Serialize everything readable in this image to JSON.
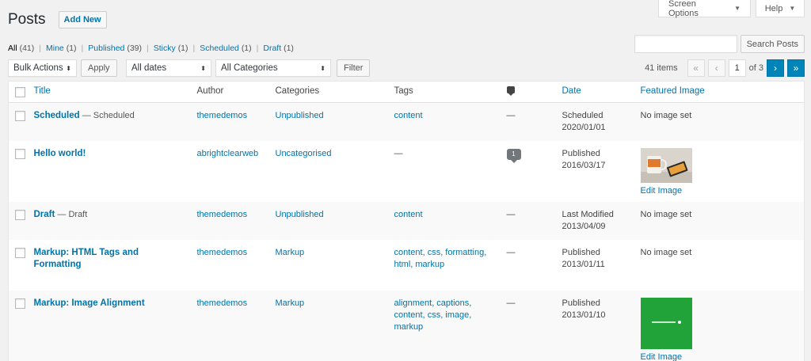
{
  "header": {
    "screen_options": "Screen Options",
    "help": "Help",
    "title": "Posts",
    "add_new": "Add New"
  },
  "filters": {
    "all": "All",
    "all_count": "(41)",
    "mine": "Mine",
    "mine_count": "(1)",
    "published": "Published",
    "published_count": "(39)",
    "sticky": "Sticky",
    "sticky_count": "(1)",
    "scheduled": "Scheduled",
    "scheduled_count": "(1)",
    "draft": "Draft",
    "draft_count": "(1)",
    "separator": "|"
  },
  "search": {
    "button": "Search Posts",
    "value": ""
  },
  "tablenav": {
    "bulk_actions": "Bulk Actions",
    "apply": "Apply",
    "dates": "All dates",
    "categories": "All Categories",
    "filter": "Filter",
    "items": "41 items",
    "first": "«",
    "prev": "‹",
    "current_page": "1",
    "of_pages": "of 3",
    "next": "›",
    "last": "»"
  },
  "columns": {
    "title": "Title",
    "author": "Author",
    "categories": "Categories",
    "tags": "Tags",
    "date": "Date",
    "featured": "Featured Image"
  },
  "rows": [
    {
      "title": "Scheduled",
      "state": " — Scheduled",
      "author": "themedemos",
      "categories": "Unpublished",
      "tags": "content",
      "comments": "—",
      "date_status": "Scheduled",
      "date": "2020/01/01",
      "featured": "No image set"
    },
    {
      "title": "Hello world!",
      "state": "",
      "author": "abrightclearweb",
      "categories": "Uncategorised",
      "tags": "—",
      "comments": "1",
      "date_status": "Published",
      "date": "2016/03/17",
      "featured": "Edit Image"
    },
    {
      "title": "Draft",
      "state": " — Draft",
      "author": "themedemos",
      "categories": "Unpublished",
      "tags": "content",
      "comments": "—",
      "date_status": "Last Modified",
      "date": "2013/04/09",
      "featured": "No image set"
    },
    {
      "title": "Markup: HTML Tags and Formatting",
      "state": "",
      "author": "themedemos",
      "categories": "Markup",
      "tags": "content, css, formatting, html, markup",
      "comments": "—",
      "date_status": "Published",
      "date": "2013/01/11",
      "featured": "No image set"
    },
    {
      "title": "Markup: Image Alignment",
      "state": "",
      "author": "themedemos",
      "categories": "Markup",
      "tags": "alignment, captions, content, css, image, markup",
      "comments": "—",
      "date_status": "Published",
      "date": "2013/01/10",
      "featured": "Edit Image"
    }
  ],
  "colors": {
    "link": "#0073aa",
    "primary_button": "#0085ba",
    "thumb_green": "#22a33a"
  },
  "icons": {
    "comments_header": "comment-bubble-icon"
  }
}
